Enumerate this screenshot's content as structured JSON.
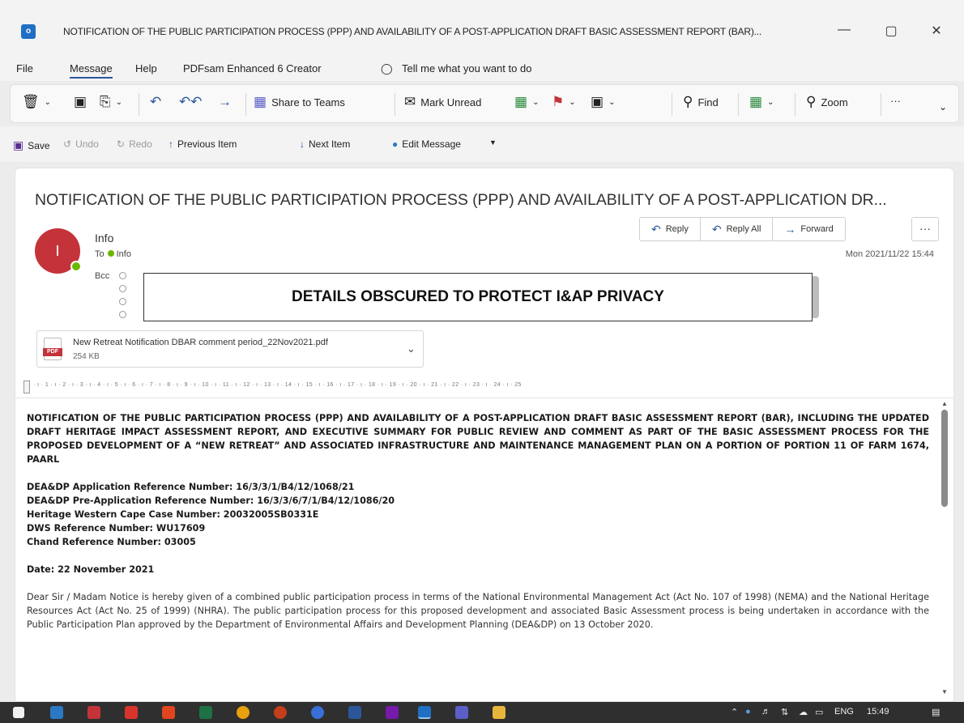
{
  "window": {
    "title": "NOTIFICATION OF THE PUBLIC PARTICIPATION PROCESS (PPP) AND AVAILABILITY OF A POST-APPLICATION DRAFT BASIC ASSESSMENT REPORT (BAR)...",
    "app_icon_text": "o",
    "minimize": "—",
    "restore": "▢",
    "close": "✕"
  },
  "menu": {
    "file": "File",
    "message": "Message",
    "help": "Help",
    "pdfsam": "PDFsam Enhanced 6 Creator",
    "tell_me": "Tell me what you want to do"
  },
  "ribbon": {
    "share_to_teams": "Share to Teams",
    "mark_unread": "Mark Unread",
    "find": "Find",
    "zoom": "Zoom",
    "more": "···"
  },
  "quick_access": {
    "save": "Save",
    "undo": "Undo",
    "redo": "Redo",
    "previous_item": "Previous Item",
    "next_item": "Next Item",
    "edit_message": "Edit Message"
  },
  "message": {
    "subject": "NOTIFICATION OF THE PUBLIC PARTICIPATION PROCESS (PPP) AND AVAILABILITY OF A POST-APPLICATION DR...",
    "avatar_initial": "I",
    "sender": "Info",
    "to_label": "To",
    "to_name": "Info",
    "bcc_label": "Bcc",
    "date": "Mon 2021/11/22 15:44",
    "reply": "Reply",
    "reply_all": "Reply All",
    "forward": "Forward",
    "more": "···",
    "privacy_notice": "DETAILS OBSCURED TO PROTECT I&AP PRIVACY"
  },
  "attachment": {
    "name": "New Retreat Notification DBAR comment period_22Nov2021.pdf",
    "size": "254 KB",
    "badge": "PDF"
  },
  "ruler": {
    "marks": "· ı · 1 · ı · 2 · ı · 3 · ı · 4 · ı · 5 · ı · 6 · ı · 7 · ı · 8 · ı · 9 · ı · 10 · ı · 11 · ı · 12 · ı · 13 · ı · 14 · ı · 15 · ı · 16 · ı · 17 · ı · 18 · ı · 19 · ı · 20 · ı · 21 · ı · 22 · ı · 23 · ı · 24 · ı · 25"
  },
  "body": {
    "heading": "NOTIFICATION OF THE PUBLIC PARTICIPATION PROCESS (PPP) AND AVAILABILITY OF A POST-APPLICATION DRAFT BASIC ASSESSMENT REPORT (BAR), INCLUDING THE UPDATED DRAFT HERITAGE IMPACT ASSESSMENT REPORT, AND EXECUTIVE SUMMARY FOR PUBLIC REVIEW AND COMMENT AS PART OF THE BASIC ASSESSMENT PROCESS FOR THE PROPOSED DEVELOPMENT OF A “NEW RETREAT” AND ASSOCIATED INFRASTRUCTURE AND MAINTENANCE MANAGEMENT PLAN ON A PORTION OF PORTION 11 OF FARM 1674, PAARL",
    "ref1": "DEA&DP Application Reference Number: 16/3/3/1/B4/12/1068/21",
    "ref2": "DEA&DP Pre-Application Reference Number: 16/3/3/6/7/1/B4/12/1086/20",
    "ref3": "Heritage Western Cape Case Number: 20032005SB0331E",
    "ref4": "DWS Reference Number: WU17609",
    "ref5": "Chand Reference Number: 03005",
    "date_line": "Date: 22 November 2021",
    "paragraph": "Dear Sir / Madam Notice is hereby given of a combined public participation process in terms of the National Environmental Management Act (Act No. 107 of 1998) (NEMA) and the National Heritage Resources Act (Act No. 25 of 1999) (NHRA). The public participation process for this proposed development and associated Basic Assessment process is being undertaken in accordance with the Public Participation Plan approved by the Department of Environmental Affairs and Development Planning (DEA&DP) on 13 October 2020."
  },
  "taskbar": {
    "language": "ENG",
    "time": "15:49"
  },
  "colors": {
    "accent": "#2b579a",
    "avatar": "#c4333a",
    "presence": "#6bb700",
    "taskbar": "#2f2f2f"
  }
}
